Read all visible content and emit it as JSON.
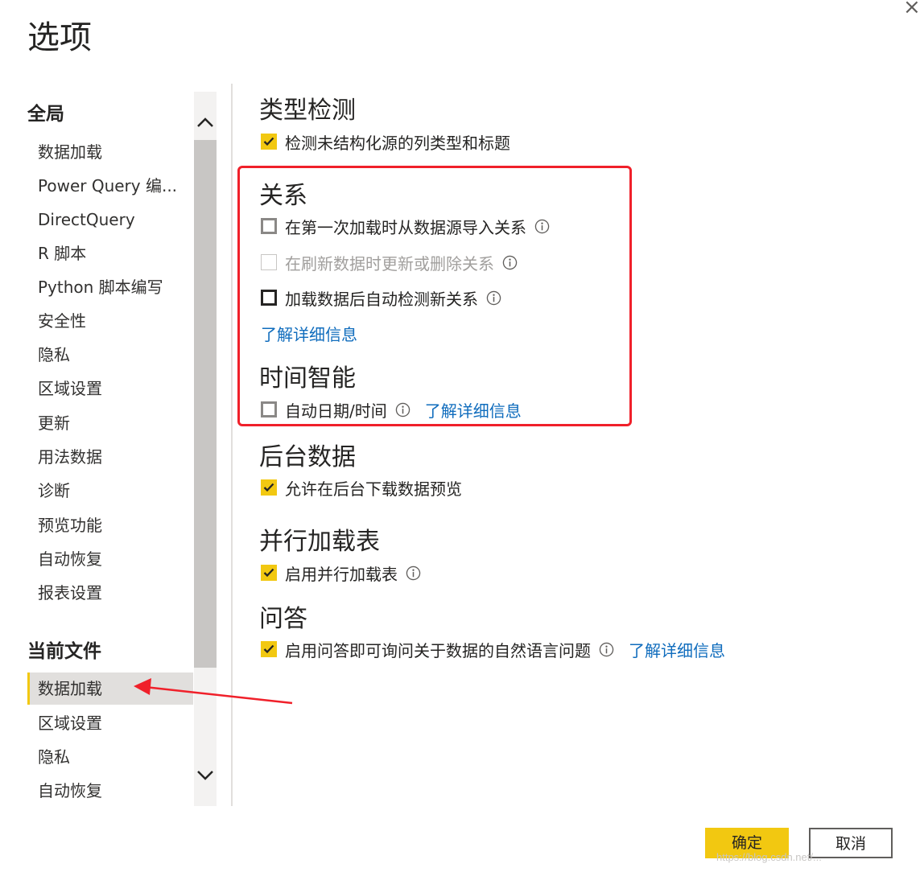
{
  "window": {
    "title": "选项",
    "close_glyph": "×"
  },
  "sidebar": {
    "global_heading": "全局",
    "global_items": [
      {
        "label": "数据加载"
      },
      {
        "label": "Power Query 编..."
      },
      {
        "label": "DirectQuery"
      },
      {
        "label": "R 脚本"
      },
      {
        "label": "Python 脚本编写"
      },
      {
        "label": "安全性"
      },
      {
        "label": "隐私"
      },
      {
        "label": "区域设置"
      },
      {
        "label": "更新"
      },
      {
        "label": "用法数据"
      },
      {
        "label": "诊断"
      },
      {
        "label": "预览功能"
      },
      {
        "label": "自动恢复"
      },
      {
        "label": "报表设置"
      }
    ],
    "current_heading": "当前文件",
    "current_items": [
      {
        "label": "数据加载",
        "selected": true
      },
      {
        "label": "区域设置"
      },
      {
        "label": "隐私"
      },
      {
        "label": "自动恢复"
      }
    ]
  },
  "content": {
    "type_detection": {
      "heading": "类型检测",
      "detect_types": {
        "label": "检测未结构化源的列类型和标题",
        "checked": true
      }
    },
    "relationships": {
      "heading": "关系",
      "import_first_load": {
        "label": "在第一次加载时从数据源导入关系",
        "checked": false
      },
      "update_on_refresh": {
        "label": "在刷新数据时更新或删除关系",
        "checked": false,
        "disabled": true
      },
      "autodetect_new": {
        "label": "加载数据后自动检测新关系",
        "checked": false
      },
      "learn_more": "了解详细信息"
    },
    "time_intelligence": {
      "heading": "时间智能",
      "auto_date": {
        "label": "自动日期/时间",
        "checked": false
      },
      "learn_more": "了解详细信息"
    },
    "background_data": {
      "heading": "后台数据",
      "allow_preview": {
        "label": "允许在后台下载数据预览",
        "checked": true
      }
    },
    "parallel_loading": {
      "heading": "并行加载表",
      "enable_parallel": {
        "label": "启用并行加载表",
        "checked": true
      }
    },
    "qa": {
      "heading": "问答",
      "enable_qa": {
        "label": "启用问答即可询问关于数据的自然语言问题",
        "checked": true
      },
      "learn_more": "了解详细信息"
    }
  },
  "footer": {
    "ok_label": "确定",
    "cancel_label": "取消"
  },
  "watermark": "https://blog.csdn.net/...",
  "icons": {
    "check": "check-icon",
    "info": "info-icon",
    "chevron_up": "chevron-up-icon",
    "chevron_down": "chevron-down-icon"
  },
  "colors": {
    "accent": "#f2c811",
    "link": "#0f6cbd",
    "highlight_box": "#f0202a"
  }
}
